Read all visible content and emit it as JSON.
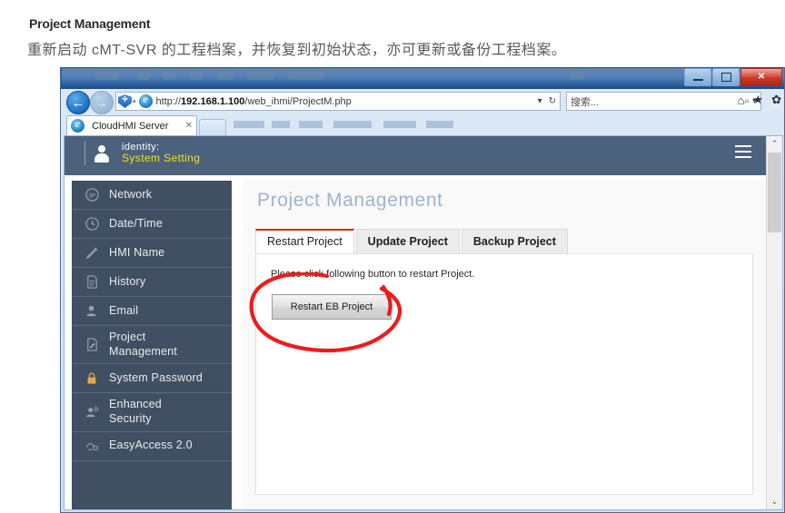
{
  "document": {
    "title": "Project Management",
    "description": "重新启动 cMT-SVR 的工程档案，并恢复到初始状态，亦可更新或备份工程档案。"
  },
  "browser": {
    "window_controls": {
      "minimize": "—",
      "maximize": "❐",
      "close": "✕"
    },
    "nav": {
      "back_icon": "←",
      "forward_icon": "→",
      "url": "http://192.168.1.100/web_ihmi/ProjectM.php",
      "url_host": "192.168.1.100",
      "url_scheme": "http://",
      "url_path": "/web_ihmi/ProjectM.php",
      "dropdown_icon": "▾",
      "refresh_icon": "↻",
      "search_placeholder": "搜索...",
      "search_icon": "⌕",
      "search_caret": "▾",
      "home_icon": "⌂",
      "favorites_icon": "★",
      "tools_icon": "✿"
    },
    "tab": {
      "label": "CloudHMI Server",
      "close_icon": "✕"
    }
  },
  "page": {
    "header": {
      "identity_label": "identity:",
      "identity_value": "System Setting",
      "menu_icon": "menu-icon"
    },
    "sidebar": {
      "items": [
        {
          "label": "Network",
          "icon": "ip-icon",
          "icon_glyph": "⒤"
        },
        {
          "label": "Date/Time",
          "icon": "clock-icon",
          "icon_glyph": "◴"
        },
        {
          "label": "HMI Name",
          "icon": "pencil-icon",
          "icon_glyph": "✎"
        },
        {
          "label": "History",
          "icon": "document-icon",
          "icon_glyph": "🗎"
        },
        {
          "label": "Email",
          "icon": "user-icon",
          "icon_glyph": "👤"
        },
        {
          "label": "Project\nManagement",
          "icon": "project-document-icon",
          "icon_glyph": "🗏"
        },
        {
          "label": "System Password",
          "icon": "lock-icon",
          "icon_glyph": "🔒"
        },
        {
          "label": "Enhanced\nSecurity",
          "icon": "user-shield-icon",
          "icon_glyph": "👥"
        },
        {
          "label": "EasyAccess 2.0",
          "icon": "easyaccess-icon",
          "icon_glyph": "⛆"
        }
      ]
    },
    "main": {
      "title": "Project Management",
      "tabs": [
        {
          "label": "Restart Project",
          "active": true
        },
        {
          "label": "Update Project",
          "active": false
        },
        {
          "label": "Backup Project",
          "active": false
        }
      ],
      "restart_panel": {
        "instruction": "Please click following button to restart Project.",
        "button_label": "Restart EB Project"
      }
    },
    "scrollbar": {
      "up_icon": "⌃",
      "down_icon": "⌄"
    }
  },
  "annotation": {
    "color": "#ee1b1b",
    "shape": "hand-drawn-circle-around-restart-button"
  }
}
